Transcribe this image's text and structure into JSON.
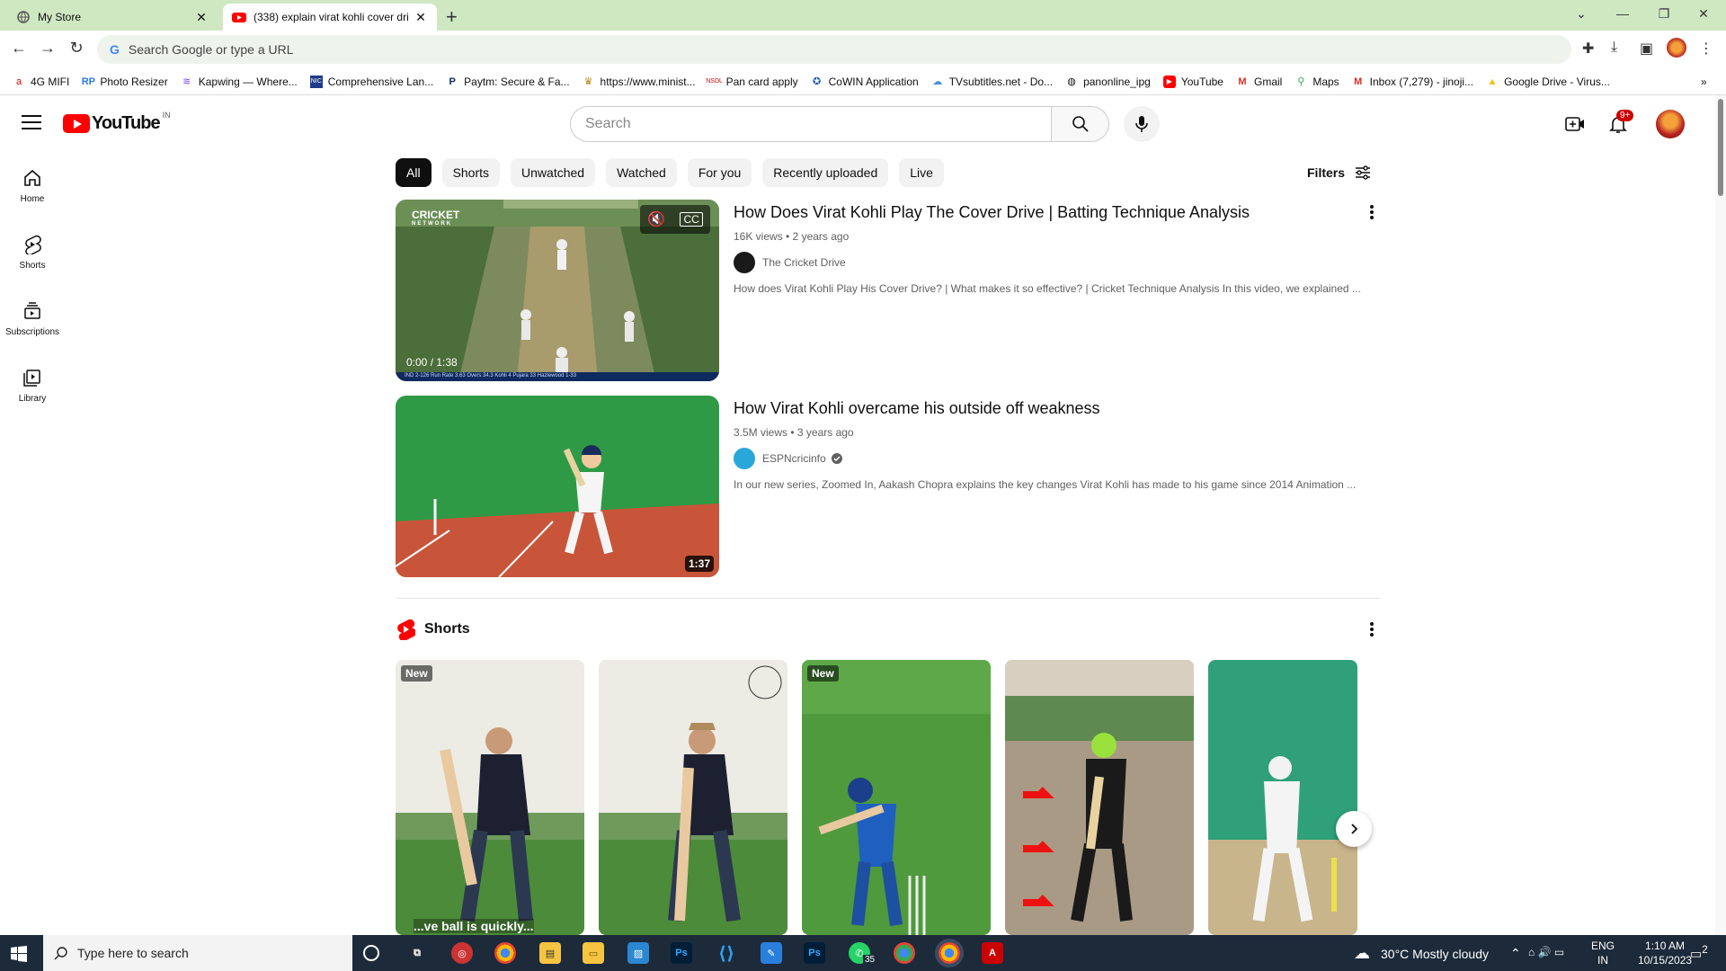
{
  "browser": {
    "tabs": [
      {
        "title": "My Store",
        "active": false
      },
      {
        "title": "(338) explain virat kohli cover dri",
        "active": true
      }
    ],
    "omnibox_placeholder": "Search Google or type a URL",
    "bookmarks": [
      {
        "label": "4G MIFI",
        "icon": "airtel-icon"
      },
      {
        "label": "Photo Resizer",
        "icon": "rp-icon"
      },
      {
        "label": "Kapwing — Where...",
        "icon": "kapwing-icon"
      },
      {
        "label": "Comprehensive Lan...",
        "icon": "nic-icon"
      },
      {
        "label": "Paytm: Secure & Fa...",
        "icon": "paytm-icon"
      },
      {
        "label": "https://www.minist...",
        "icon": "emblem-icon"
      },
      {
        "label": "Pan card apply",
        "icon": "nsdl-icon"
      },
      {
        "label": "CoWIN Application",
        "icon": "cowin-icon"
      },
      {
        "label": "TVsubtitles.net - Do...",
        "icon": "tvsubtitles-icon"
      },
      {
        "label": "panonline_ipg",
        "icon": "globe-icon"
      },
      {
        "label": "YouTube",
        "icon": "youtube-icon"
      },
      {
        "label": "Gmail",
        "icon": "gmail-icon"
      },
      {
        "label": "Maps",
        "icon": "maps-icon"
      },
      {
        "label": "Inbox (7,279) - jinoji...",
        "icon": "gmail-icon"
      },
      {
        "label": "Google Drive - Virus...",
        "icon": "drive-icon"
      }
    ]
  },
  "youtube": {
    "logo_country": "IN",
    "search_placeholder": "Search",
    "notification_count": "9+",
    "guide": [
      {
        "label": "Home",
        "icon": "home-icon"
      },
      {
        "label": "Shorts",
        "icon": "shorts-icon"
      },
      {
        "label": "Subscriptions",
        "icon": "subscriptions-icon"
      },
      {
        "label": "Library",
        "icon": "library-icon"
      }
    ],
    "chips": [
      "All",
      "Shorts",
      "Unwatched",
      "Watched",
      "For you",
      "Recently uploaded",
      "Live"
    ],
    "filters_label": "Filters",
    "videos": [
      {
        "title": "How Does Virat Kohli Play The Cover Drive | Batting Technique Analysis",
        "meta": "16K views • 2 years ago",
        "channel": "The Cricket Drive",
        "description": "How does Virat Kohli Play His Cover Drive? | What makes it so effective? | Cricket Technique Analysis In this video, we explained ...",
        "time": "0:00 / 1:38",
        "overlay_logo": "CRICKET",
        "overlay_sub": "NETWORK",
        "scorebar": "IND 2-126   Run Rate 3.63   Overs 34.3   Kohli 4   Pujara 33   Hazlewood 1-33"
      },
      {
        "title": "How Virat Kohli overcame his outside off weakness",
        "meta": "3.5M views • 3 years ago",
        "channel": "ESPNcricinfo",
        "verified": true,
        "description": "In our new series, Zoomed In, Aakash Chopra explains the key changes Virat Kohli has made to his game since 2014 Animation ...",
        "duration": "1:37"
      }
    ],
    "shorts_heading": "Shorts",
    "shorts": [
      {
        "tag": "New",
        "caption": "...ve ball is quickly..."
      },
      {
        "tag": ""
      },
      {
        "tag": "New"
      },
      {
        "tag": ""
      },
      {
        "tag": ""
      }
    ]
  },
  "taskbar": {
    "search_placeholder": "Type here to search",
    "whatsapp_badge": "35",
    "weather": "30°C  Mostly cloudy",
    "lang": "ENG",
    "region": "IN",
    "time": "1:10 AM",
    "date": "10/15/2023",
    "notif_count": "2"
  },
  "colors": {
    "tabstrip": "#cfe8c2",
    "youtube_red": "#ff0000",
    "taskbar": "#1c2a3a",
    "pitch_green": "#2f9a45"
  }
}
